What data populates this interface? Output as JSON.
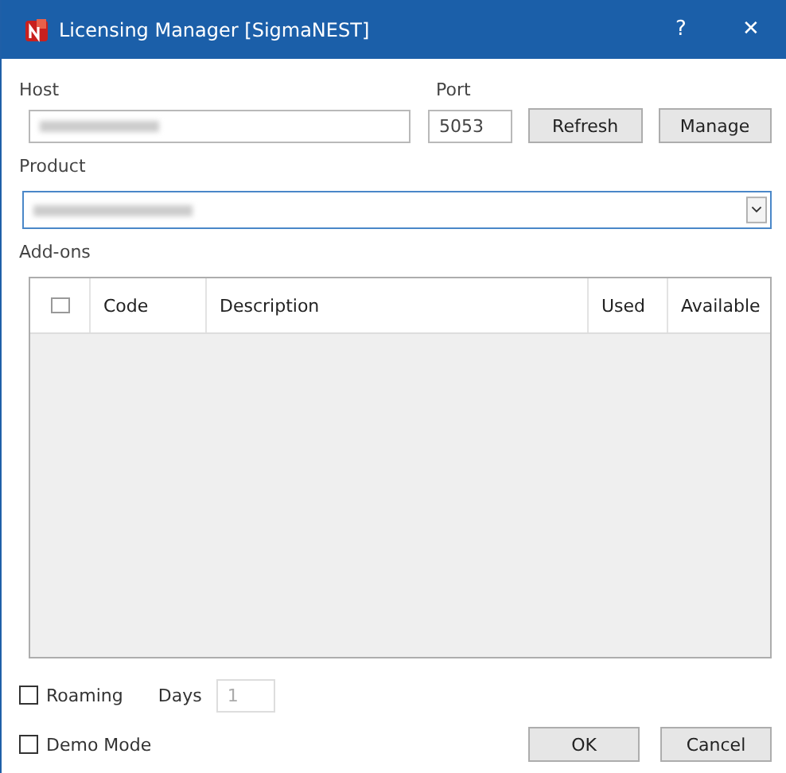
{
  "window": {
    "title": "Licensing Manager [SigmaNEST]",
    "help": "?",
    "close": "✕"
  },
  "host": {
    "label": "Host"
  },
  "port": {
    "label": "Port",
    "value": "5053"
  },
  "buttons_top": [
    "Refresh",
    "Manage"
  ],
  "product": {
    "label": "Product"
  },
  "addons": {
    "label": "Add-ons",
    "select_all_checked": false,
    "columns": [
      "Code",
      "Description",
      "Used",
      "Available"
    ]
  },
  "roaming": {
    "label": "Roaming",
    "checked": false
  },
  "days": {
    "label": "Days",
    "value": "1",
    "disabled": true
  },
  "demo_mode": {
    "label": "Demo Mode",
    "checked": false
  },
  "buttons_bottom": [
    "OK",
    "Cancel"
  ]
}
